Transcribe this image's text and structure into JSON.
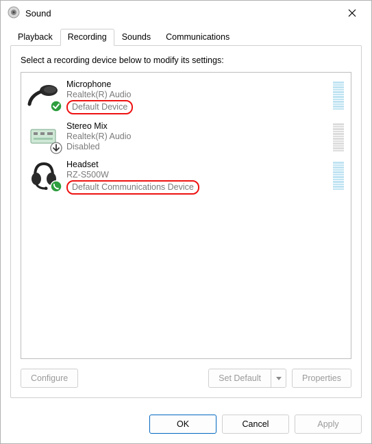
{
  "window": {
    "title": "Sound"
  },
  "tabs": {
    "playback": "Playback",
    "recording": "Recording",
    "sounds": "Sounds",
    "communications": "Communications",
    "active": "recording"
  },
  "panel": {
    "instruction": "Select a recording device below to modify its settings:",
    "buttons": {
      "configure": "Configure",
      "set_default": "Set Default",
      "properties": "Properties"
    }
  },
  "devices": [
    {
      "name": "Microphone",
      "vendor": "Realtek(R) Audio",
      "status": "Default Device",
      "meter": "active",
      "badge": "check",
      "highlighted": true
    },
    {
      "name": "Stereo Mix",
      "vendor": "Realtek(R) Audio",
      "status": "Disabled",
      "meter": "disabled",
      "badge": "down",
      "highlighted": false
    },
    {
      "name": "Headset",
      "vendor": "RZ-S500W",
      "status": "Default Communications Device",
      "meter": "active",
      "badge": "phone",
      "highlighted": true
    }
  ],
  "footer": {
    "ok": "OK",
    "cancel": "Cancel",
    "apply": "Apply"
  }
}
